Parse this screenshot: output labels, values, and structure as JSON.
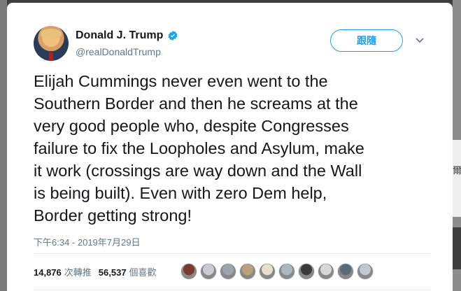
{
  "tweet": {
    "author": {
      "display_name": "Donald J. Trump",
      "handle": "@realDonaldTrump",
      "verified": true
    },
    "follow_label": "跟隨",
    "text": "Elijah Cummings never even went to the\nSouthern Border and then he screams at the\nvery good people who, despite Congresses\nfailure to fix the Loopholes and Asylum, make\nit work (crossings are way down and the Wall\nis being built). Even with zero Dem help,\nBorder getting strong!",
    "timestamp": "下午6:34 - 2019年7月29日",
    "stats": {
      "retweets_count": "14,876",
      "retweets_label": "次轉推",
      "likes_count": "56,537",
      "likes_label": "個喜歡"
    },
    "likers": [
      {
        "icon": "liker-avatar",
        "color": "#7a3b2e"
      },
      {
        "icon": "liker-avatar",
        "color": "#c9ccd1"
      },
      {
        "icon": "liker-avatar",
        "color": "#9aa5b1"
      },
      {
        "icon": "liker-avatar",
        "color": "#b8a27a"
      },
      {
        "icon": "liker-avatar",
        "color": "#e6e0c8"
      },
      {
        "icon": "liker-avatar",
        "color": "#aab8c2"
      },
      {
        "icon": "liker-avatar",
        "color": "#3a3a3a"
      },
      {
        "icon": "liker-avatar",
        "color": "#d8d8d8"
      },
      {
        "icon": "liker-avatar",
        "color": "#5c6b73"
      },
      {
        "icon": "liker-avatar",
        "color": "#c0c8d0"
      }
    ]
  },
  "background": {
    "right_glyph": "爾"
  },
  "colors": {
    "accent": "#1da1f2",
    "text": "#14171a",
    "secondary_text": "#657786"
  }
}
